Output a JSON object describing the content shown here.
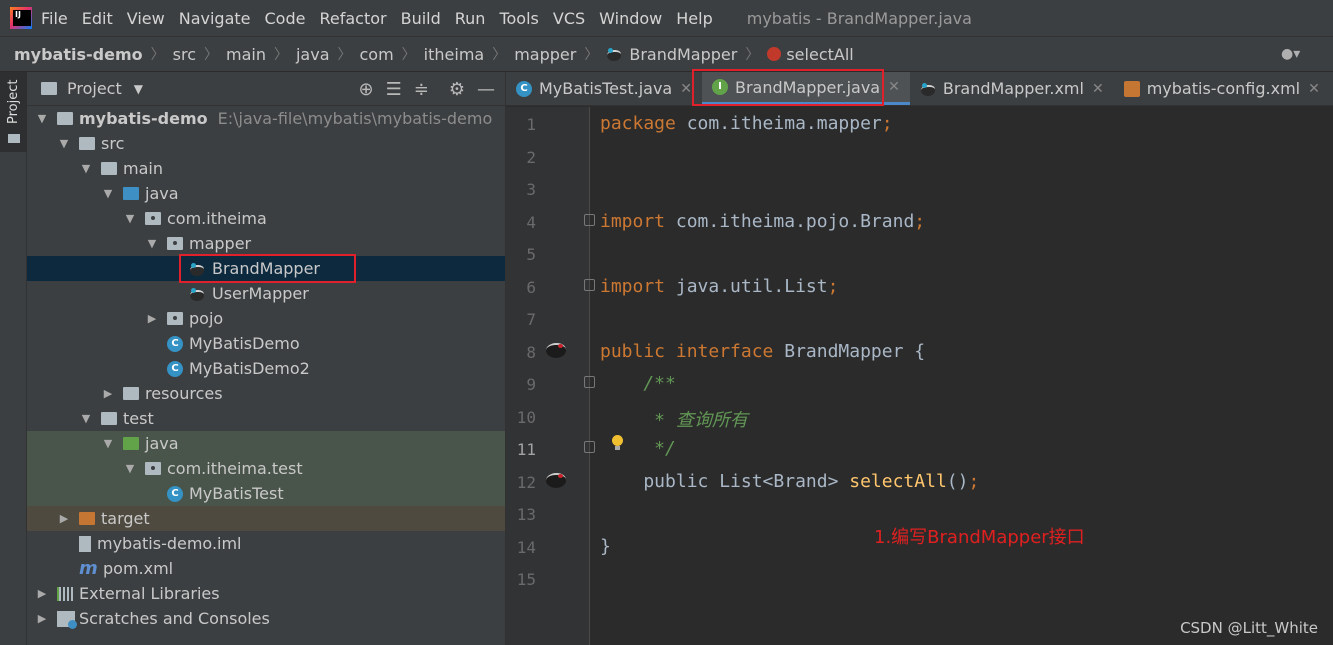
{
  "menubar": {
    "items": [
      "File",
      "Edit",
      "View",
      "Navigate",
      "Code",
      "Refactor",
      "Build",
      "Run",
      "Tools",
      "VCS",
      "Window",
      "Help"
    ],
    "window_title": "mybatis - BrandMapper.java"
  },
  "breadcrumb": [
    "mybatis-demo",
    "src",
    "main",
    "java",
    "com",
    "itheima",
    "mapper",
    "BrandMapper",
    "selectAll"
  ],
  "project_panel": {
    "title": "Project",
    "vertical_tab": "Project",
    "tree": {
      "root_name": "mybatis-demo",
      "root_path": "E:\\java-file\\mybatis\\mybatis-demo",
      "src": "src",
      "main": "main",
      "java": "java",
      "pkg": "com.itheima",
      "mapper": "mapper",
      "brand_mapper": "BrandMapper",
      "user_mapper": "UserMapper",
      "pojo": "pojo",
      "demo1": "MyBatisDemo",
      "demo2": "MyBatisDemo2",
      "resources": "resources",
      "test": "test",
      "test_java": "java",
      "test_pkg": "com.itheima.test",
      "test_class": "MyBatisTest",
      "target": "target",
      "iml": "mybatis-demo.iml",
      "pom": "pom.xml",
      "libs": "External Libraries",
      "scratches": "Scratches and Consoles"
    }
  },
  "tabs": [
    {
      "label": "MyBatisTest.java",
      "icon": "class-icon"
    },
    {
      "label": "BrandMapper.java",
      "icon": "interface-icon",
      "active": true
    },
    {
      "label": "BrandMapper.xml",
      "icon": "mybatis-icon"
    },
    {
      "label": "mybatis-config.xml",
      "icon": "xml-config-icon"
    }
  ],
  "editor": {
    "line_numbers": [
      "1",
      "2",
      "3",
      "4",
      "5",
      "6",
      "7",
      "8",
      "9",
      "10",
      "11",
      "12",
      "13",
      "14",
      "15"
    ],
    "current_line": "11",
    "code": {
      "l1_kw": "package",
      "l1_rest": " com.itheima.mapper",
      "l4_kw": "import",
      "l4_rest": " com.itheima.pojo.Brand",
      "l6_kw": "import",
      "l6_rest": " java.util.List",
      "l8_kw": "public interface",
      "l8_rest": " BrandMapper {",
      "l9": "    /**",
      "l10": "     * 查询所有",
      "l11": "     */",
      "l12_pre": "    public List<Brand> ",
      "l12_fn": "selectAll",
      "l12_post": "()",
      "l14": "}",
      "semicolon": ";"
    }
  },
  "annotation": "1.编写BrandMapper接口",
  "watermark": "CSDN @Litt_White"
}
